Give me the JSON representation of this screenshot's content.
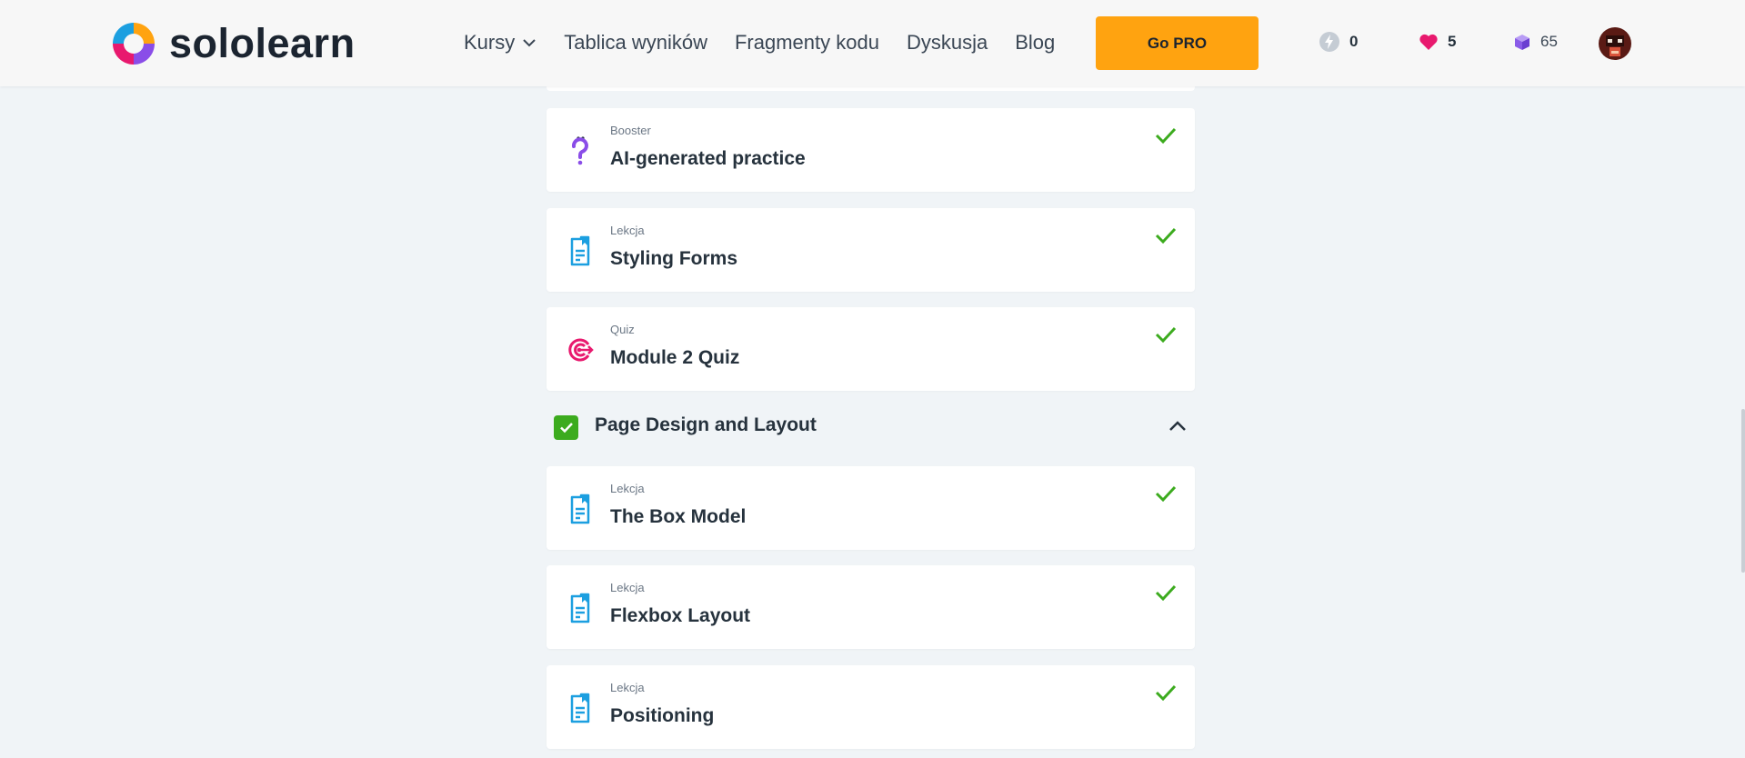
{
  "brand": {
    "name": "sololearn",
    "colors": {
      "accent": "#ffa310",
      "success": "#3cab1e",
      "lesson_icon": "#1c9fe0",
      "quiz_icon": "#e8196e",
      "booster_icon": "#8a4de8"
    }
  },
  "nav": {
    "courses": "Kursy",
    "leaderboard": "Tablica wyników",
    "code_snippets": "Fragmenty kodu",
    "discussion": "Dyskusja",
    "blog": "Blog",
    "go_pro": "Go PRO"
  },
  "stats": {
    "streak": "0",
    "hearts": "5",
    "bits": "65"
  },
  "items": [
    {
      "type": "Booster",
      "title": "AI-generated practice",
      "icon": "booster-icon",
      "completed": true
    },
    {
      "type": "Lekcja",
      "title": "Styling Forms",
      "icon": "lesson-icon",
      "completed": true
    },
    {
      "type": "Quiz",
      "title": "Module 2 Quiz",
      "icon": "quiz-icon",
      "completed": true
    }
  ],
  "module": {
    "title": "Page Design and Layout",
    "completed": true,
    "expanded": true,
    "items": [
      {
        "type": "Lekcja",
        "title": "The Box Model",
        "icon": "lesson-icon",
        "completed": true
      },
      {
        "type": "Lekcja",
        "title": "Flexbox Layout",
        "icon": "lesson-icon",
        "completed": true
      },
      {
        "type": "Lekcja",
        "title": "Positioning",
        "icon": "lesson-icon",
        "completed": true
      }
    ]
  }
}
